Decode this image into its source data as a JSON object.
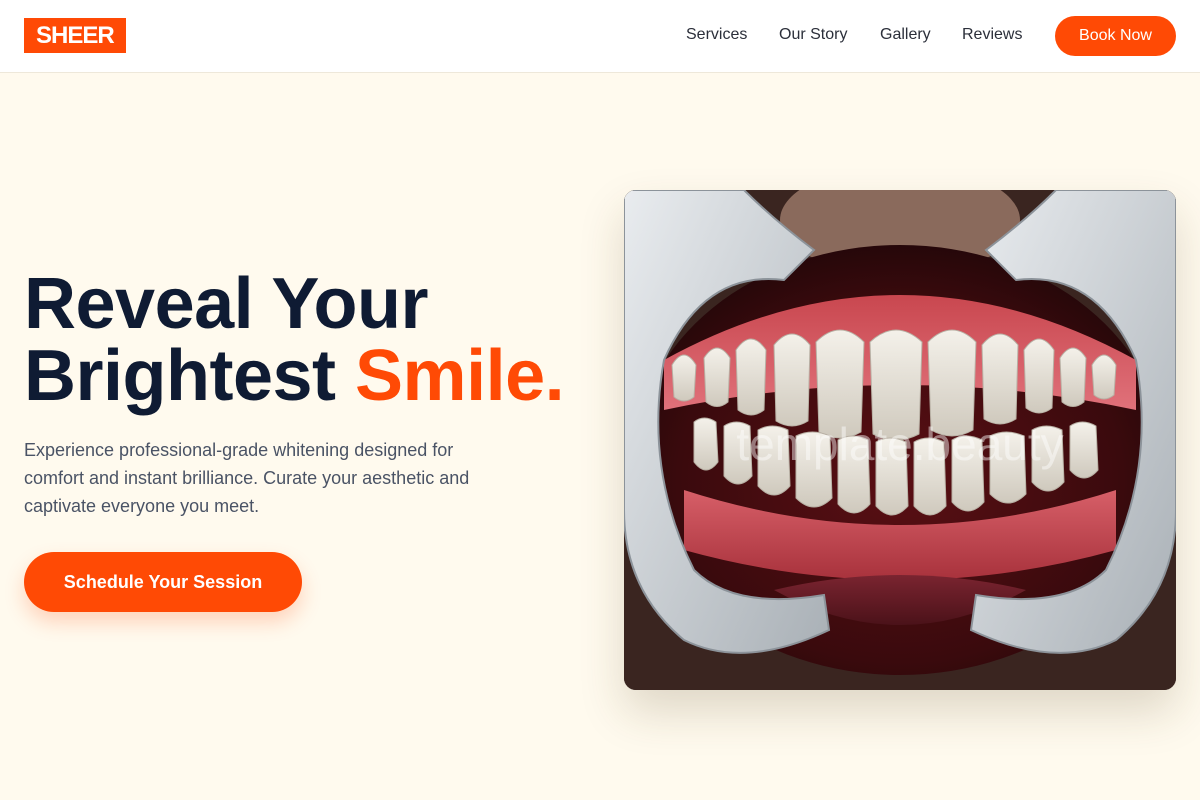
{
  "header": {
    "logo": "SHEER",
    "nav": [
      "Services",
      "Our Story",
      "Gallery",
      "Reviews"
    ],
    "book_button": "Book Now"
  },
  "hero": {
    "title_line1": "Reveal Your",
    "title_line2_start": "Brightest ",
    "title_accent": "Smile.",
    "description": "Experience professional-grade whitening designed for comfort and instant brilliance. Curate your aesthetic and captivate everyone you meet.",
    "cta_label": "Schedule Your Session"
  },
  "image": {
    "subject": "open mouth with white teeth held by cheek retractors",
    "watermark": "template.beauty"
  },
  "colors": {
    "accent": "#ff4a05",
    "navy": "#0f1b33",
    "background": "#fffaee"
  }
}
